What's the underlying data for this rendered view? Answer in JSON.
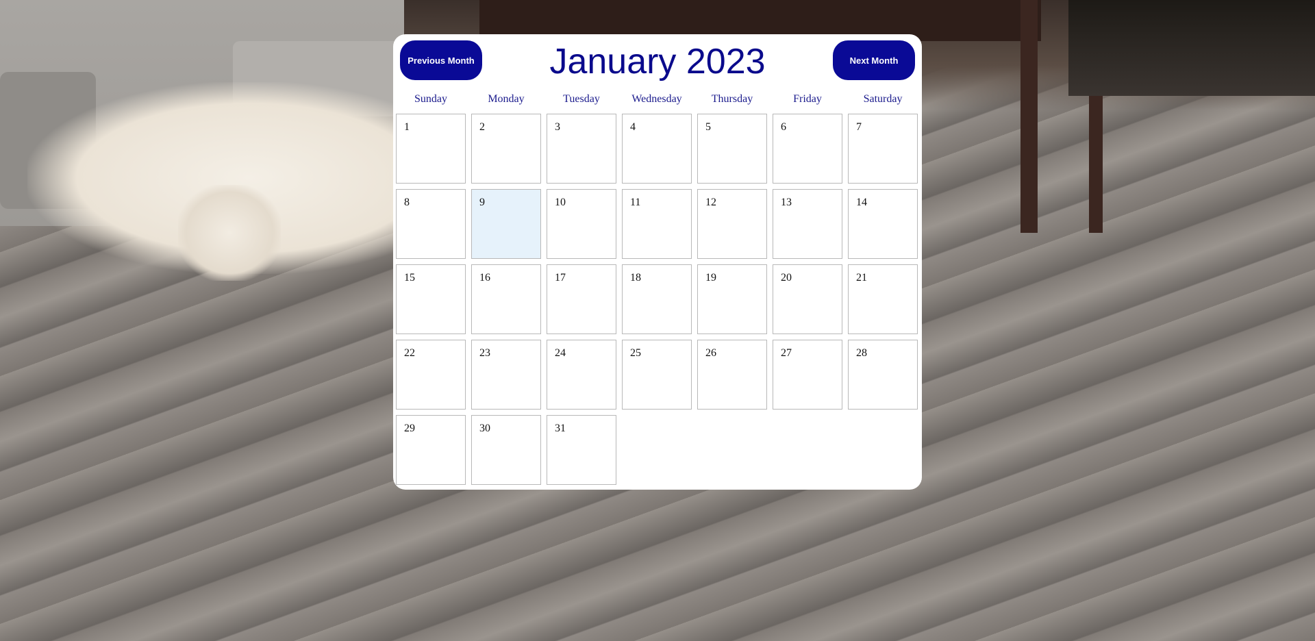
{
  "calendar": {
    "title": "January 2023",
    "prev_label": "Previous Month",
    "next_label": "Next Month",
    "weekdays": [
      "Sunday",
      "Monday",
      "Tuesday",
      "Wednesday",
      "Thursday",
      "Friday",
      "Saturday"
    ],
    "leading_blanks": 0,
    "days_in_month": 31,
    "today": 9,
    "days": [
      "1",
      "2",
      "3",
      "4",
      "5",
      "6",
      "7",
      "8",
      "9",
      "10",
      "11",
      "12",
      "13",
      "14",
      "15",
      "16",
      "17",
      "18",
      "19",
      "20",
      "21",
      "22",
      "23",
      "24",
      "25",
      "26",
      "27",
      "28",
      "29",
      "30",
      "31"
    ]
  },
  "colors": {
    "accent": "#0a0a96",
    "title": "#0a0a8c",
    "today_bg": "#e6f2fb",
    "cell_border": "#b8b8b8"
  }
}
